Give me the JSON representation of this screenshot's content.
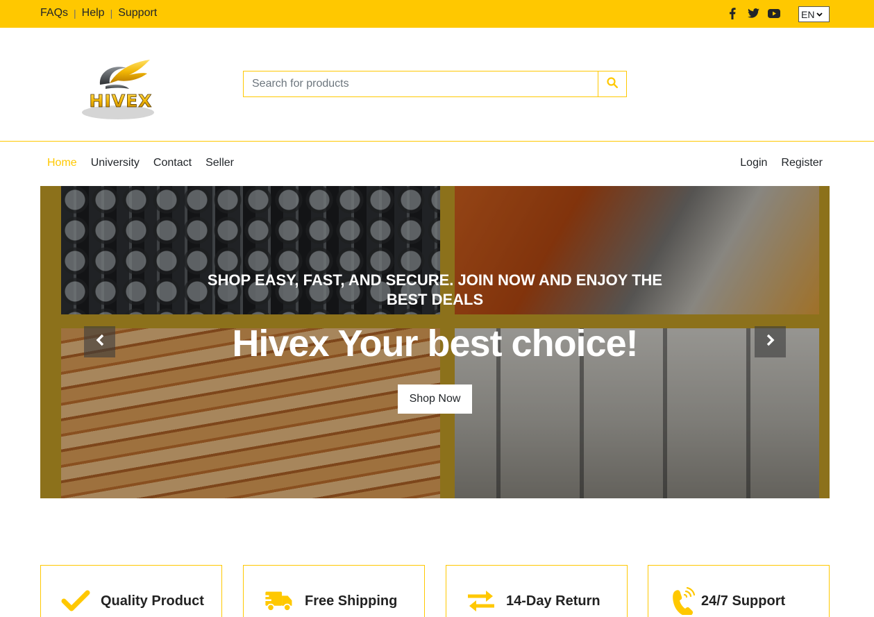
{
  "topbar": {
    "links": [
      "FAQs",
      "Help",
      "Support"
    ],
    "social_icons": [
      "facebook-icon",
      "twitter-icon",
      "youtube-icon"
    ],
    "language": "EN",
    "background": "#FFC800"
  },
  "header": {
    "logo_text": "HIVEX",
    "search": {
      "placeholder": "Search for products",
      "button_icon": "search-icon"
    }
  },
  "nav": {
    "left": [
      {
        "label": "Home",
        "active": true
      },
      {
        "label": "University",
        "active": false
      },
      {
        "label": "Contact",
        "active": false
      },
      {
        "label": "Seller",
        "active": false
      }
    ],
    "right": [
      {
        "label": "Login"
      },
      {
        "label": "Register"
      }
    ]
  },
  "hero": {
    "tagline": "SHOP EASY, FAST, AND SECURE. JOIN NOW AND ENJOY THE BEST DEALS",
    "headline": "Hivex Your best choice!",
    "cta": "Shop Now",
    "prev_icon": "chevron-left-icon",
    "next_icon": "chevron-right-icon"
  },
  "features": [
    {
      "label": "Quality Product",
      "icon": "check-icon"
    },
    {
      "label": "Free Shipping",
      "icon": "truck-icon"
    },
    {
      "label": "14-Day Return",
      "icon": "exchange-icon"
    },
    {
      "label": "24/7 Support",
      "icon": "phone-icon"
    }
  ],
  "colors": {
    "accent": "#FFC800",
    "text": "#212529"
  }
}
